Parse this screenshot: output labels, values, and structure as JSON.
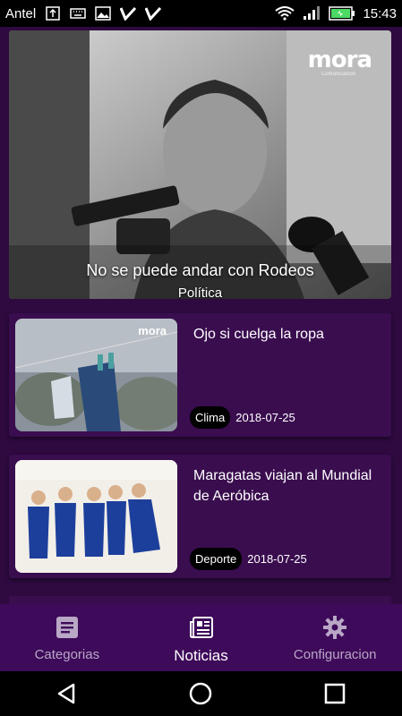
{
  "status_bar": {
    "carrier": "Antel",
    "time": "15:43"
  },
  "hero": {
    "title": "No se puede andar con Rodeos",
    "category": "Política",
    "logo": "mora",
    "logo_sub": "Comunicación"
  },
  "cards": [
    {
      "title": "Ojo si cuelga la ropa",
      "category": "Clima",
      "date": "2018-07-25",
      "thumb_logo": "mora"
    },
    {
      "title": "Maragatas viajan al Mundial de Aeróbica",
      "category": "Deporte",
      "date": "2018-07-25"
    }
  ],
  "bottom_nav": {
    "items": [
      {
        "label": "Categorias",
        "icon": "list-icon"
      },
      {
        "label": "Noticias",
        "icon": "newspaper-icon",
        "active": true
      },
      {
        "label": "Configuracion",
        "icon": "gear-icon"
      }
    ]
  },
  "system_nav": {
    "items": [
      "back-icon",
      "home-icon",
      "recents-icon"
    ]
  },
  "colors": {
    "background": "#2e0a40",
    "card": "#3a0d4f",
    "nav": "#3e0a5a",
    "battery": "#4cd964"
  }
}
